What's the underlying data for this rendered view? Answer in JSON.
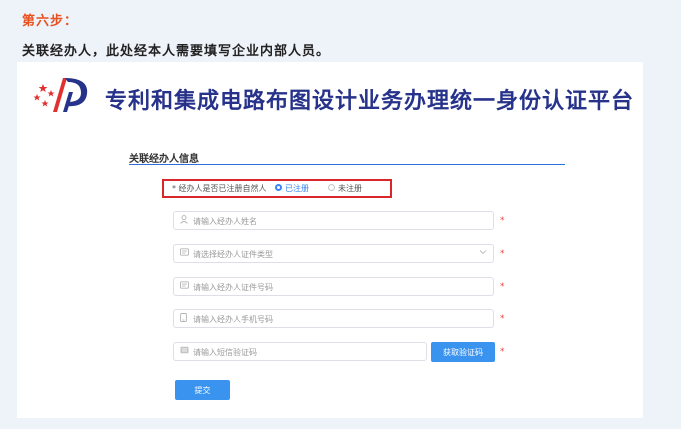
{
  "header": {
    "step_title": "第六步：",
    "description": "关联经办人，此处经本人需要填写企业内部人员。"
  },
  "platform": {
    "title": "专利和集成电路布图设计业务办理统一身份认证平台",
    "logo_icon": "patent-office-logo"
  },
  "form": {
    "section_title": "关联经办人信息",
    "registered": {
      "label": "* 经办人是否已注册自然人",
      "options": [
        {
          "label": "已注册",
          "selected": true
        },
        {
          "label": "未注册",
          "selected": false
        }
      ]
    },
    "fields": [
      {
        "placeholder": "请输入经办人姓名",
        "icon": "user-icon",
        "required_mark": "*"
      },
      {
        "placeholder": "请选择经办人证件类型",
        "icon": "id-card-icon",
        "required_mark": "*",
        "dropdown_icon": "chevron-down-icon"
      },
      {
        "placeholder": "请输入经办人证件号码",
        "icon": "id-card-icon",
        "required_mark": "*"
      },
      {
        "placeholder": "请输入经办人手机号码",
        "icon": "phone-icon",
        "required_mark": "*"
      },
      {
        "placeholder": "请输入短信验证码",
        "icon": "message-icon",
        "required_mark": "*"
      }
    ],
    "get_code_button": "获取验证码",
    "submit_button": "提交"
  },
  "colors": {
    "accent": "#3a93ee",
    "highlight_box": "#d9262b",
    "step_title": "#e8501e",
    "platform_title": "#27328a"
  }
}
